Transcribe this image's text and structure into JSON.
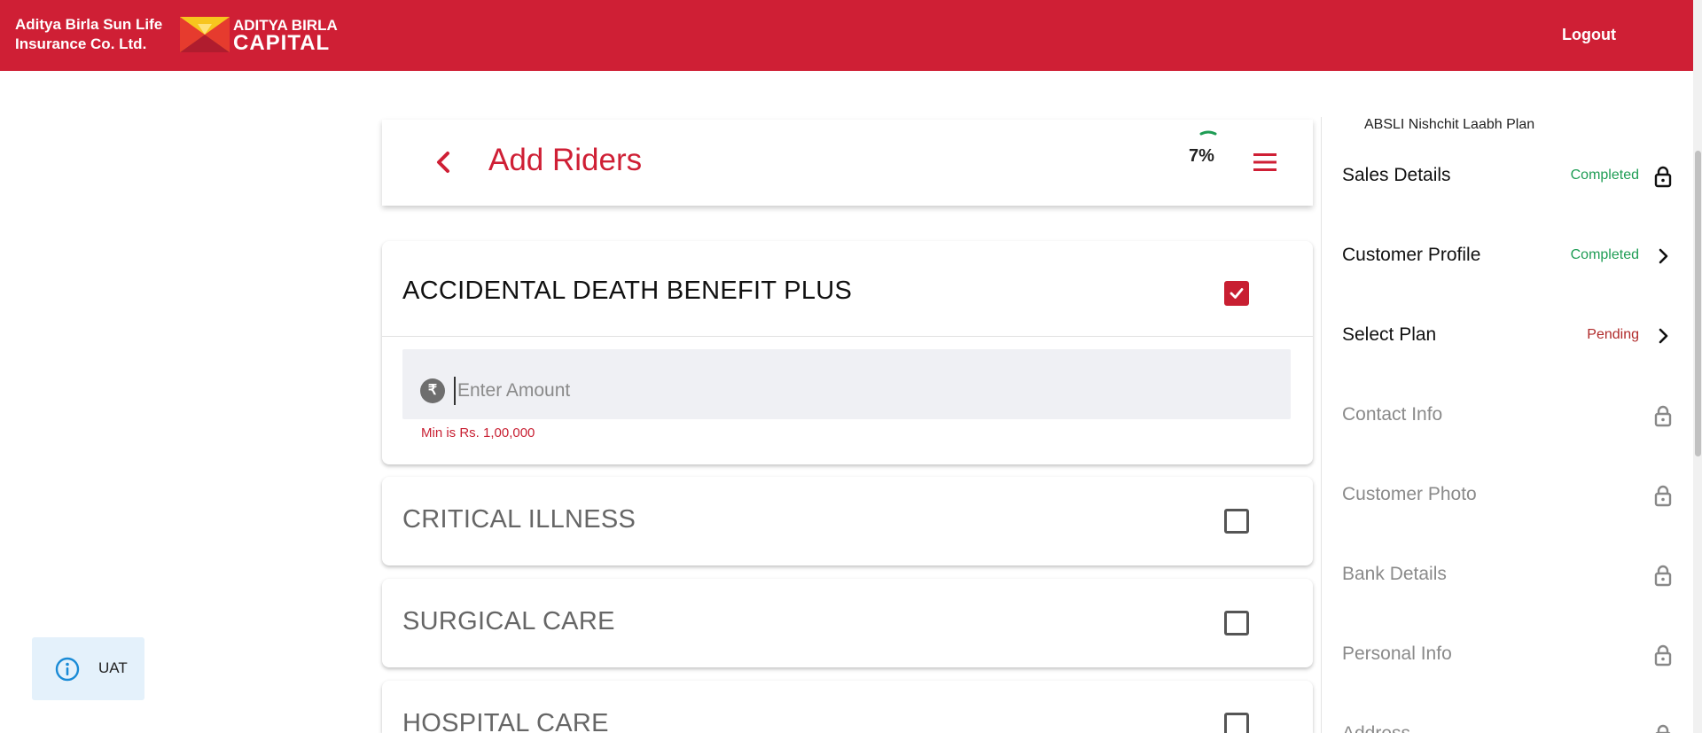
{
  "header": {
    "brand_line1": "Aditya Birla Sun Life",
    "brand_line2": "Insurance Co. Ltd.",
    "logo_line1": "ADITYA BIRLA",
    "logo_line2": "CAPITAL",
    "logout_label": "Logout",
    "brand_color": "#cf1f35"
  },
  "page": {
    "title": "Add Riders",
    "progress_text": "7%",
    "progress_value": 7,
    "back_icon": "chevron-left-icon",
    "menu_icon": "hamburger-menu-icon"
  },
  "riders": [
    {
      "name": "ACCIDENTAL DEATH BENEFIT PLUS",
      "checked": true,
      "amount_placeholder": "Enter Amount",
      "amount_value": "",
      "currency_symbol": "₹",
      "error": "Min is Rs. 1,00,000"
    },
    {
      "name": "CRITICAL ILLNESS",
      "checked": false
    },
    {
      "name": "SURGICAL CARE",
      "checked": false
    },
    {
      "name": "HOSPITAL CARE",
      "checked": false
    }
  ],
  "sidebar": {
    "plan_name": "ABSLI Nishchit Laabh Plan",
    "steps": [
      {
        "label": "Sales Details",
        "status": "Completed",
        "icon": "lock-icon",
        "enabled": true
      },
      {
        "label": "Customer Profile",
        "status": "Completed",
        "icon": "chevron-right-icon",
        "enabled": true
      },
      {
        "label": "Select Plan",
        "status": "Pending",
        "icon": "chevron-right-icon",
        "enabled": true
      },
      {
        "label": "Contact Info",
        "status": "",
        "icon": "lock-icon",
        "enabled": false
      },
      {
        "label": "Customer Photo",
        "status": "",
        "icon": "lock-icon",
        "enabled": false
      },
      {
        "label": "Bank Details",
        "status": "",
        "icon": "lock-icon",
        "enabled": false
      },
      {
        "label": "Personal Info",
        "status": "",
        "icon": "lock-icon",
        "enabled": false
      },
      {
        "label": "Address",
        "status": "",
        "icon": "lock-icon",
        "enabled": false
      }
    ]
  },
  "env_badge": {
    "label": "UAT",
    "icon": "info-icon"
  }
}
